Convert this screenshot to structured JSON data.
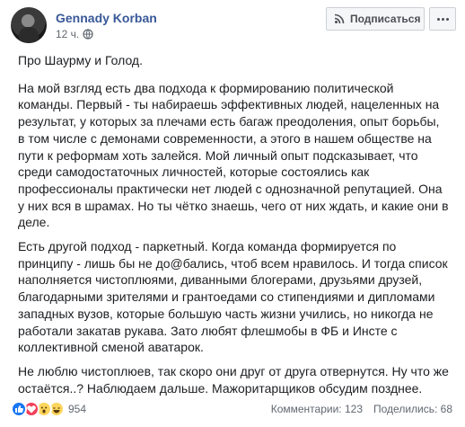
{
  "author": {
    "name": "Gennady Korban",
    "time": "12 ч."
  },
  "header": {
    "subscribe_label": "Подписаться"
  },
  "post": {
    "title": "Про Шаурму и Голод.",
    "paragraphs": [
      "На мой взгляд есть два подхода к формированию политической команды. Первый - ты набираешь эффективных людей, нацеленных на результат, у которых за плечами есть багаж преодоления, опыт борьбы, в том числе с демонами современности, а этого в нашем обществе на пути к реформам хоть залейся. Мой личный опыт подсказывает, что среди самодостаточных личностей, которые состоялись как профессионалы практически нет людей с однозначной репутацией. Она у них вся в шрамах. Но ты чётко знаешь, чего от них ждать, и какие они в деле.",
      "Есть другой подход - паркетный. Когда команда формируется по принципу - лишь бы не до@бались, чтоб всем нравилось. И тогда список наполняется чистоплюями, диванными блогерами, друзьями друзей, благодарными зрителями и грантоедами со стипендиями и дипломами западных вузов, которые большую часть жизни учились, но никогда не работали закатав рукава. Зато любят флешмобы в ФБ и Инсте с коллективной сменой аватарок.",
      "Не люблю чистоплюев, так скоро они друг от друга отвернутся. Ну что же остаётся..? Наблюдаем дальше. Мажоритарщиков обсудим позднее."
    ]
  },
  "footer": {
    "reaction_count": "954",
    "comments": "Комментарии: 123",
    "shares": "Поделились: 68",
    "reactions": [
      "like-icon",
      "love-icon",
      "wow-icon",
      "haha-icon"
    ]
  },
  "colors": {
    "author_link": "#385898",
    "text": "#1c1e21",
    "muted": "#606770",
    "like": "#1877f2",
    "love": "#f33e58",
    "emoji": "#fcd55c"
  }
}
